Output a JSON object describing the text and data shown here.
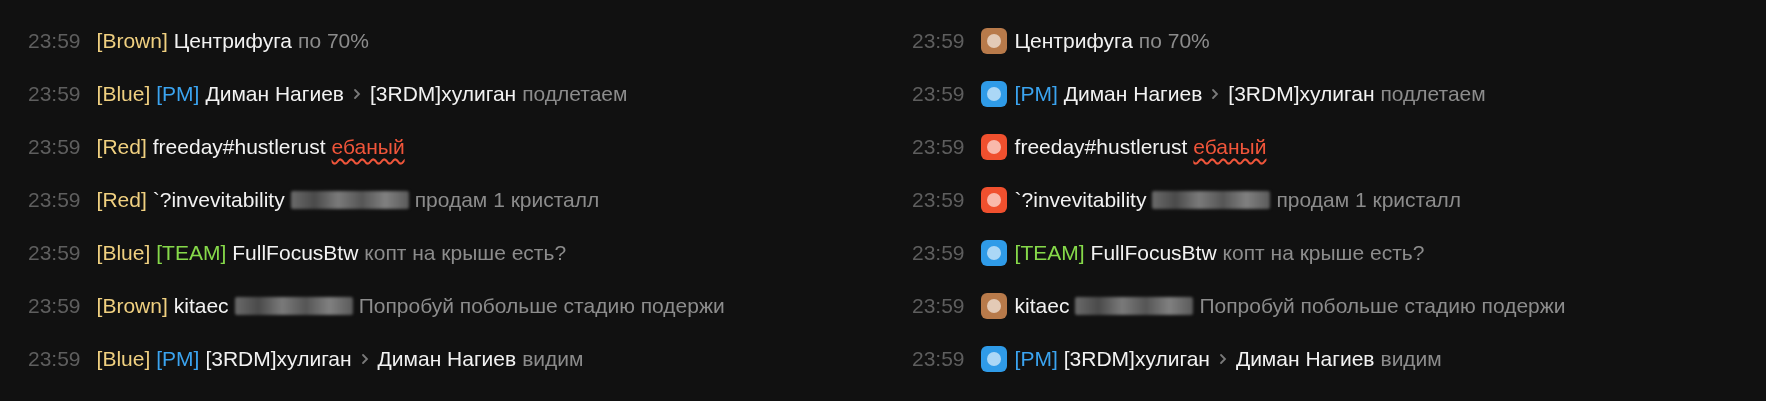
{
  "panels": [
    {
      "kind": "label",
      "messages": [
        {
          "time": "23:59",
          "team": "[Brown]",
          "sender": "Центрифуга",
          "redacted": false,
          "text": "по 70%",
          "flagged": false
        },
        {
          "time": "23:59",
          "team": "[Blue]",
          "channel": {
            "kind": "pm",
            "label": "[PM]"
          },
          "sender": "Диман Нагиев",
          "recipient": "[3RDM]хулиган",
          "redacted": false,
          "text": "подлетаем",
          "flagged": false
        },
        {
          "time": "23:59",
          "team": "[Red]",
          "sender": "freeday#hustlerust",
          "redacted": false,
          "text": "ебаный",
          "flagged": true
        },
        {
          "time": "23:59",
          "team": "[Red]",
          "sender": "`?invevitability",
          "redacted": true,
          "text": "продам 1 кристалл",
          "flagged": false
        },
        {
          "time": "23:59",
          "team": "[Blue]",
          "channel": {
            "kind": "team",
            "label": "[TEAM]"
          },
          "sender": "FullFocusBtw",
          "redacted": false,
          "text": "копт на крыше есть?",
          "flagged": false
        },
        {
          "time": "23:59",
          "team": "[Brown]",
          "sender": "kitaec",
          "redacted": true,
          "text": "Попробуй побольше стадию подержи",
          "flagged": false
        },
        {
          "time": "23:59",
          "team": "[Blue]",
          "channel": {
            "kind": "pm",
            "label": "[PM]"
          },
          "sender": "[3RDM]хулиган",
          "recipient": "Диман Нагиев",
          "redacted": false,
          "text": "видим",
          "flagged": false
        }
      ]
    },
    {
      "kind": "icon",
      "messages": [
        {
          "time": "23:59",
          "color": "#b87a4a",
          "sender": "Центрифуга",
          "redacted": false,
          "text": "по 70%",
          "flagged": false
        },
        {
          "time": "23:59",
          "color": "#2f9be8",
          "channel": {
            "kind": "pm",
            "label": "[PM]"
          },
          "sender": "Диман Нагиев",
          "recipient": "[3RDM]хулиган",
          "redacted": false,
          "text": "подлетаем",
          "flagged": false
        },
        {
          "time": "23:59",
          "color": "#f0502e",
          "sender": "freeday#hustlerust",
          "redacted": false,
          "text": "ебаный",
          "flagged": true
        },
        {
          "time": "23:59",
          "color": "#f0502e",
          "sender": "`?invevitability",
          "redacted": true,
          "text": "продам 1 кристалл",
          "flagged": false
        },
        {
          "time": "23:59",
          "color": "#2f9be8",
          "channel": {
            "kind": "team",
            "label": "[TEAM]"
          },
          "sender": "FullFocusBtw",
          "redacted": false,
          "text": "копт на крыше есть?",
          "flagged": false
        },
        {
          "time": "23:59",
          "color": "#b87a4a",
          "sender": "kitaec",
          "redacted": true,
          "text": "Попробуй побольше стадию подержи",
          "flagged": false
        },
        {
          "time": "23:59",
          "color": "#2f9be8",
          "channel": {
            "kind": "pm",
            "label": "[PM]"
          },
          "sender": "[3RDM]хулиган",
          "recipient": "Диман Нагиев",
          "redacted": false,
          "text": "видим",
          "flagged": false
        }
      ]
    }
  ]
}
